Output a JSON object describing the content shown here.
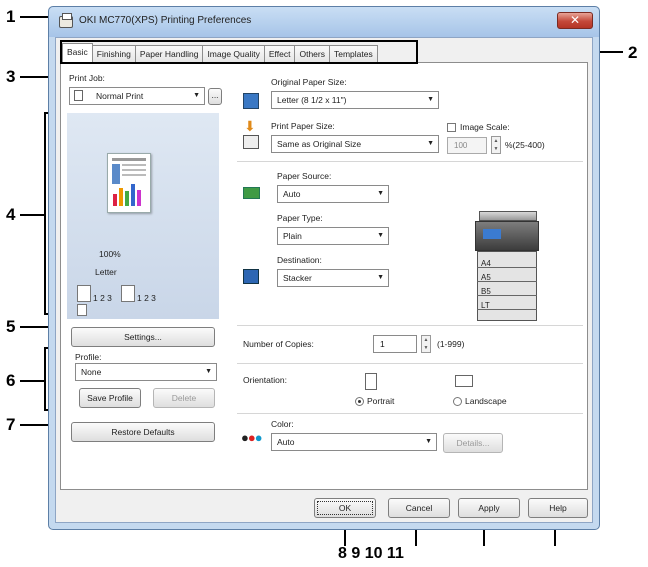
{
  "window": {
    "title": "OKI MC770(XPS) Printing Preferences",
    "close_glyph": "✕"
  },
  "tabs": [
    {
      "label": "Basic"
    },
    {
      "label": "Finishing"
    },
    {
      "label": "Paper Handling"
    },
    {
      "label": "Image Quality"
    },
    {
      "label": "Effect"
    },
    {
      "label": "Others"
    },
    {
      "label": "Templates"
    }
  ],
  "left": {
    "print_job_label": "Print Job:",
    "print_job_value": "Normal Print",
    "more_button": "...",
    "preview": {
      "zoom": "100%",
      "paper": "Letter",
      "pages_a": "1 2 3",
      "pages_b": "1 2 3"
    },
    "settings_button": "Settings...",
    "profile_label": "Profile:",
    "profile_value": "None",
    "save_profile_button": "Save Profile",
    "delete_button": "Delete",
    "restore_defaults_button": "Restore Defaults"
  },
  "right": {
    "original_paper_size_label": "Original Paper Size:",
    "original_paper_size_value": "Letter (8 1/2 x 11\")",
    "print_paper_size_label": "Print Paper Size:",
    "print_paper_size_value": "Same as Original Size",
    "image_scale_label": "Image Scale:",
    "image_scale_value": "100",
    "image_scale_range": "%(25-400)",
    "paper_source_label": "Paper Source:",
    "paper_source_value": "Auto",
    "paper_type_label": "Paper Type:",
    "paper_type_value": "Plain",
    "destination_label": "Destination:",
    "destination_value": "Stacker",
    "trays": [
      "A4",
      "A5",
      "B5",
      "LT"
    ],
    "copies_label": "Number of Copies:",
    "copies_value": "1",
    "copies_range": "(1-999)",
    "orientation_label": "Orientation:",
    "portrait_label": "Portrait",
    "landscape_label": "Landscape",
    "color_label": "Color:",
    "color_value": "Auto",
    "details_button": "Details..."
  },
  "bottom": {
    "ok_button": "OK",
    "cancel_button": "Cancel",
    "apply_button": "Apply",
    "help_button": "Help"
  },
  "callouts": {
    "c1": "1",
    "c2": "2",
    "c3": "3",
    "c4": "4",
    "c5": "5",
    "c6": "6",
    "c7": "7",
    "bottom_numbers": "8 9 10 11"
  },
  "colors": {
    "accent_blue": "#c9d6e8",
    "close_red": "#c4493a",
    "tab_border": "#8d8d8d"
  }
}
